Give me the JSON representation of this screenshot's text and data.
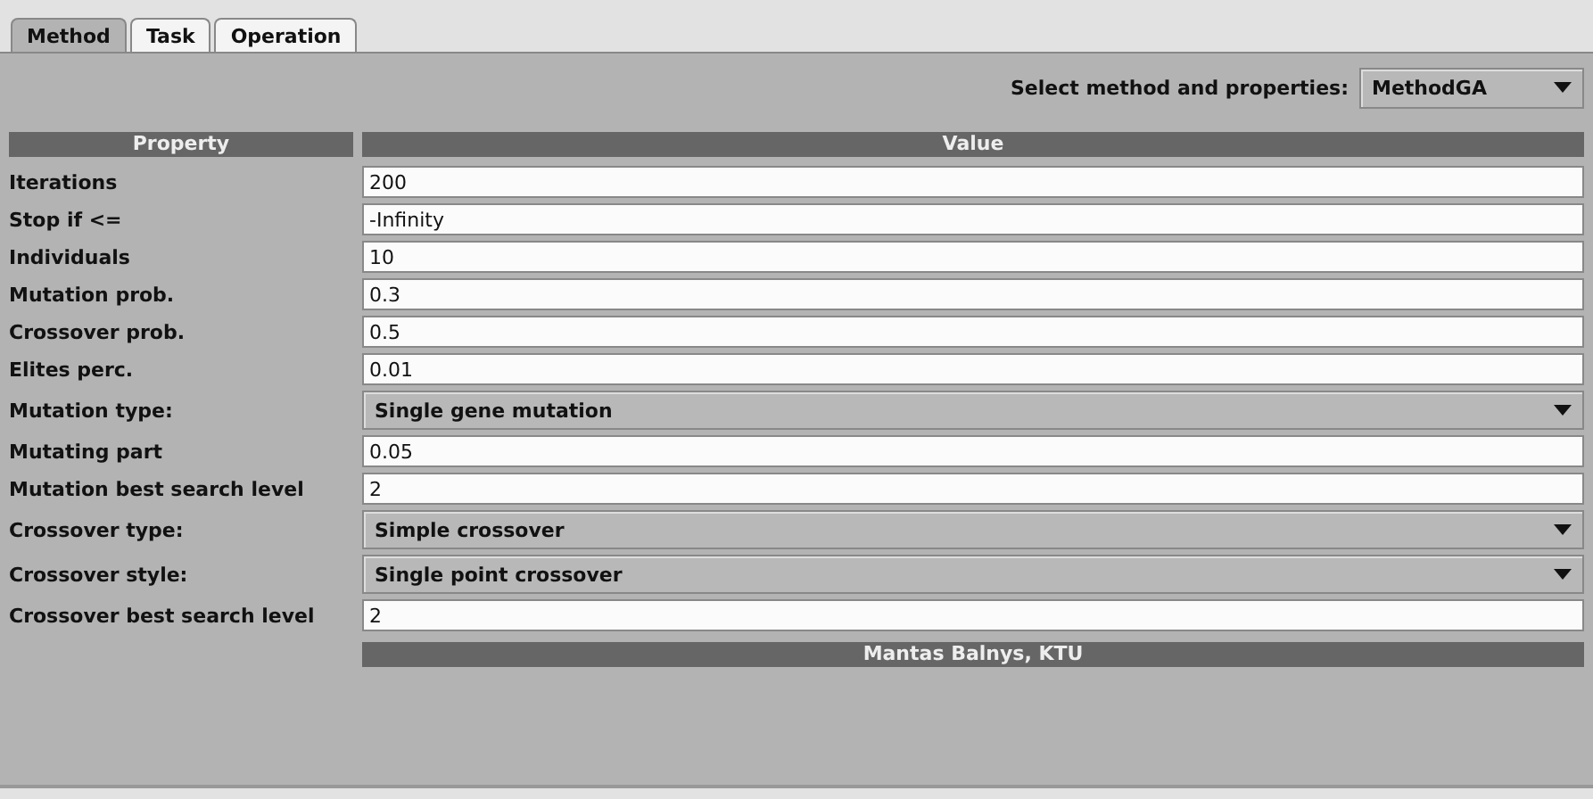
{
  "tabs": [
    {
      "label": "Method",
      "selected": true
    },
    {
      "label": "Task",
      "selected": false
    },
    {
      "label": "Operation",
      "selected": false
    }
  ],
  "selector": {
    "label": "Select method and properties:",
    "value": "MethodGA"
  },
  "table": {
    "columns": [
      "Property",
      "Value"
    ],
    "rows": [
      {
        "property": "Iterations",
        "kind": "field",
        "value": "200"
      },
      {
        "property": "Stop if <=",
        "kind": "field",
        "value": "-Infinity"
      },
      {
        "property": "Individuals",
        "kind": "field",
        "value": "10"
      },
      {
        "property": "Mutation prob.",
        "kind": "field",
        "value": "0.3"
      },
      {
        "property": "Crossover prob.",
        "kind": "field",
        "value": "0.5"
      },
      {
        "property": "Elites perc.",
        "kind": "field",
        "value": "0.01"
      },
      {
        "property": "Mutation type:",
        "kind": "combo",
        "value": "Single gene mutation"
      },
      {
        "property": "Mutating part",
        "kind": "field",
        "value": "0.05"
      },
      {
        "property": "Mutation best search level",
        "kind": "field",
        "value": "2"
      },
      {
        "property": "Crossover type:",
        "kind": "combo",
        "value": "Simple crossover"
      },
      {
        "property": "Crossover style:",
        "kind": "combo",
        "value": "Single point crossover"
      },
      {
        "property": "Crossover best search level",
        "kind": "field",
        "value": "2"
      }
    ]
  },
  "footer": "Mantas Balnys, KTU"
}
